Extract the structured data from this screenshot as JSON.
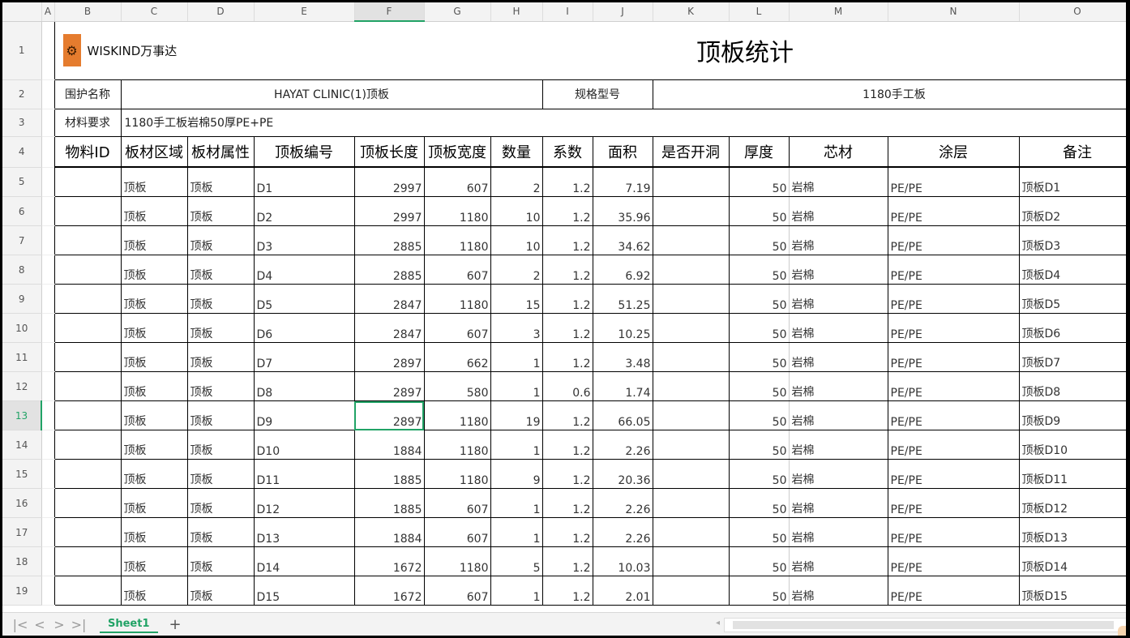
{
  "columns": [
    "A",
    "B",
    "C",
    "D",
    "E",
    "F",
    "G",
    "H",
    "I",
    "J",
    "K",
    "L",
    "M",
    "N",
    "O"
  ],
  "selected_column": "F",
  "selected_row": "13",
  "logo": {
    "text": "WISKIND万事达",
    "icon": "wiskind-logo-icon"
  },
  "title": "顶板统计",
  "row2": {
    "label1": "围护名称",
    "value1": "HAYAT CLINIC(1)顶板",
    "label2": "规格型号",
    "value2": "1180手工板"
  },
  "row3": {
    "label": "材料要求",
    "value": "1180手工板岩棉50厚PE+PE"
  },
  "headers": [
    "物料ID",
    "板材区域",
    "板材属性",
    "顶板编号",
    "顶板长度",
    "顶板宽度",
    "数量",
    "系数",
    "面积",
    "是否开洞",
    "厚度",
    "芯材",
    "涂层",
    "备注"
  ],
  "rows": [
    {
      "num": "5",
      "id": "",
      "region": "顶板",
      "attr": "顶板",
      "code": "D1",
      "length": "2997",
      "width": "607",
      "qty": "2",
      "coef": "1.2",
      "area": "7.19",
      "hole": "",
      "thick": "50",
      "core": "岩棉",
      "coat": "PE/PE",
      "note": "顶板D1"
    },
    {
      "num": "6",
      "id": "",
      "region": "顶板",
      "attr": "顶板",
      "code": "D2",
      "length": "2997",
      "width": "1180",
      "qty": "10",
      "coef": "1.2",
      "area": "35.96",
      "hole": "",
      "thick": "50",
      "core": "岩棉",
      "coat": "PE/PE",
      "note": "顶板D2"
    },
    {
      "num": "7",
      "id": "",
      "region": "顶板",
      "attr": "顶板",
      "code": "D3",
      "length": "2885",
      "width": "1180",
      "qty": "10",
      "coef": "1.2",
      "area": "34.62",
      "hole": "",
      "thick": "50",
      "core": "岩棉",
      "coat": "PE/PE",
      "note": "顶板D3"
    },
    {
      "num": "8",
      "id": "",
      "region": "顶板",
      "attr": "顶板",
      "code": "D4",
      "length": "2885",
      "width": "607",
      "qty": "2",
      "coef": "1.2",
      "area": "6.92",
      "hole": "",
      "thick": "50",
      "core": "岩棉",
      "coat": "PE/PE",
      "note": "顶板D4"
    },
    {
      "num": "9",
      "id": "",
      "region": "顶板",
      "attr": "顶板",
      "code": "D5",
      "length": "2847",
      "width": "1180",
      "qty": "15",
      "coef": "1.2",
      "area": "51.25",
      "hole": "",
      "thick": "50",
      "core": "岩棉",
      "coat": "PE/PE",
      "note": "顶板D5"
    },
    {
      "num": "10",
      "id": "",
      "region": "顶板",
      "attr": "顶板",
      "code": "D6",
      "length": "2847",
      "width": "607",
      "qty": "3",
      "coef": "1.2",
      "area": "10.25",
      "hole": "",
      "thick": "50",
      "core": "岩棉",
      "coat": "PE/PE",
      "note": "顶板D6"
    },
    {
      "num": "11",
      "id": "",
      "region": "顶板",
      "attr": "顶板",
      "code": "D7",
      "length": "2897",
      "width": "662",
      "qty": "1",
      "coef": "1.2",
      "area": "3.48",
      "hole": "",
      "thick": "50",
      "core": "岩棉",
      "coat": "PE/PE",
      "note": "顶板D7"
    },
    {
      "num": "12",
      "id": "",
      "region": "顶板",
      "attr": "顶板",
      "code": "D8",
      "length": "2897",
      "width": "580",
      "qty": "1",
      "coef": "0.6",
      "area": "1.74",
      "hole": "",
      "thick": "50",
      "core": "岩棉",
      "coat": "PE/PE",
      "note": "顶板D8"
    },
    {
      "num": "13",
      "id": "",
      "region": "顶板",
      "attr": "顶板",
      "code": "D9",
      "length": "2897",
      "width": "1180",
      "qty": "19",
      "coef": "1.2",
      "area": "66.05",
      "hole": "",
      "thick": "50",
      "core": "岩棉",
      "coat": "PE/PE",
      "note": "顶板D9"
    },
    {
      "num": "14",
      "id": "",
      "region": "顶板",
      "attr": "顶板",
      "code": "D10",
      "length": "1884",
      "width": "1180",
      "qty": "1",
      "coef": "1.2",
      "area": "2.26",
      "hole": "",
      "thick": "50",
      "core": "岩棉",
      "coat": "PE/PE",
      "note": "顶板D10"
    },
    {
      "num": "15",
      "id": "",
      "region": "顶板",
      "attr": "顶板",
      "code": "D11",
      "length": "1885",
      "width": "1180",
      "qty": "9",
      "coef": "1.2",
      "area": "20.36",
      "hole": "",
      "thick": "50",
      "core": "岩棉",
      "coat": "PE/PE",
      "note": "顶板D11"
    },
    {
      "num": "16",
      "id": "",
      "region": "顶板",
      "attr": "顶板",
      "code": "D12",
      "length": "1885",
      "width": "607",
      "qty": "1",
      "coef": "1.2",
      "area": "2.26",
      "hole": "",
      "thick": "50",
      "core": "岩棉",
      "coat": "PE/PE",
      "note": "顶板D12"
    },
    {
      "num": "17",
      "id": "",
      "region": "顶板",
      "attr": "顶板",
      "code": "D13",
      "length": "1884",
      "width": "607",
      "qty": "1",
      "coef": "1.2",
      "area": "2.26",
      "hole": "",
      "thick": "50",
      "core": "岩棉",
      "coat": "PE/PE",
      "note": "顶板D13"
    },
    {
      "num": "18",
      "id": "",
      "region": "顶板",
      "attr": "顶板",
      "code": "D14",
      "length": "1672",
      "width": "1180",
      "qty": "5",
      "coef": "1.2",
      "area": "10.03",
      "hole": "",
      "thick": "50",
      "core": "岩棉",
      "coat": "PE/PE",
      "note": "顶板D14"
    },
    {
      "num": "19",
      "id": "",
      "region": "顶板",
      "attr": "顶板",
      "code": "D15",
      "length": "1672",
      "width": "607",
      "qty": "1",
      "coef": "1.2",
      "area": "2.01",
      "hole": "",
      "thick": "50",
      "core": "岩棉",
      "coat": "PE/PE",
      "note": "顶板D15"
    }
  ],
  "row_labels_top": [
    "1",
    "2",
    "3",
    "4"
  ],
  "tabbar": {
    "nav": [
      "|<",
      "<",
      ">",
      ">|"
    ],
    "sheet": "Sheet1",
    "add": "+"
  },
  "colors": {
    "accent": "#21a366",
    "logo": "#e57c2e"
  }
}
